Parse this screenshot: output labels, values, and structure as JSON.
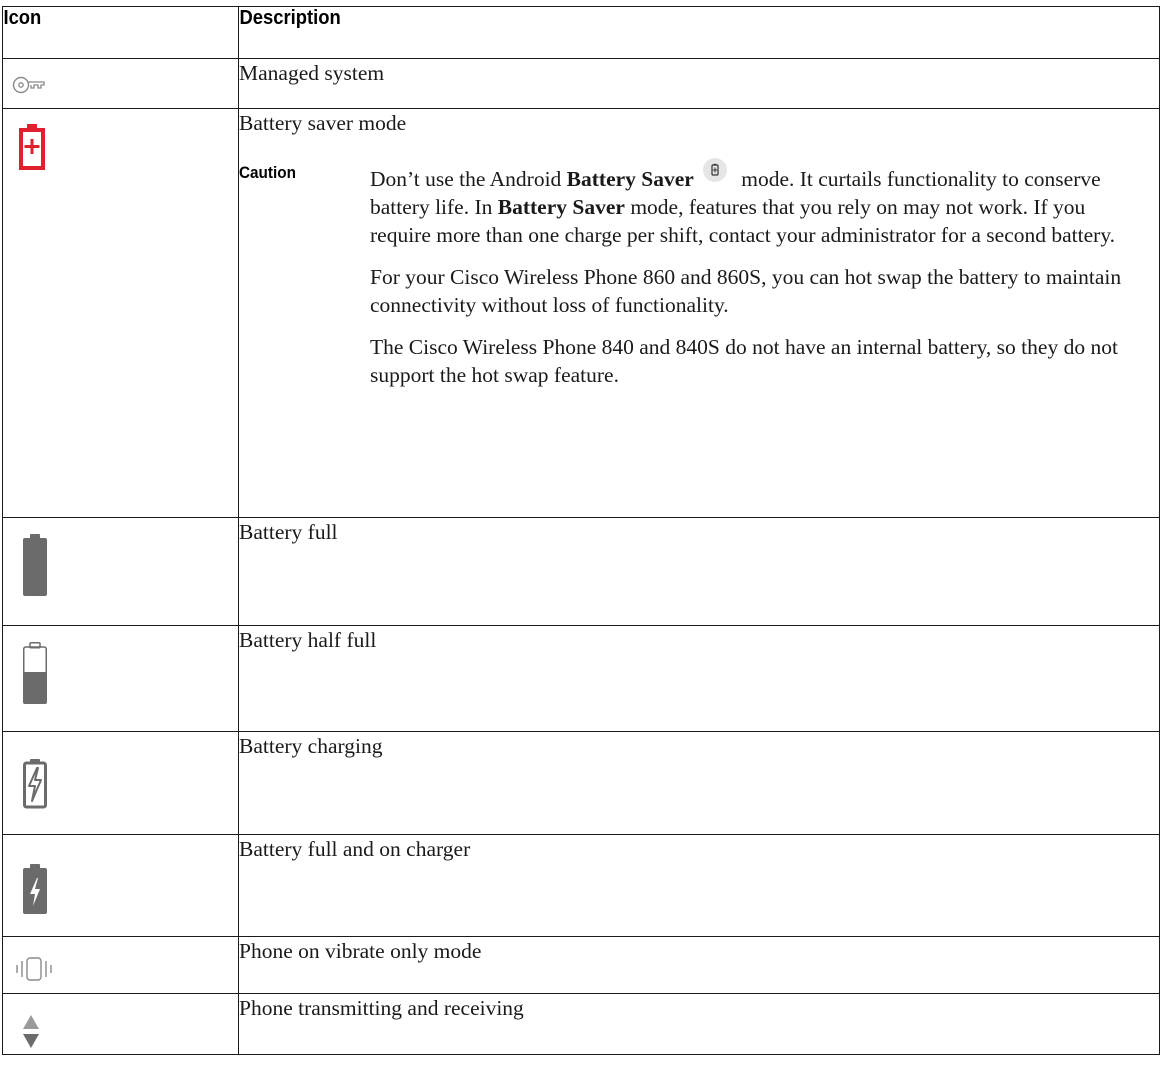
{
  "table": {
    "headers": {
      "icon": "Icon",
      "description": "Description"
    },
    "rows": [
      {
        "icon": "key-icon",
        "description": "Managed system"
      },
      {
        "icon": "battery-saver-icon",
        "description": "Battery saver mode"
      },
      {
        "icon": "battery-full-icon",
        "description": "Battery full"
      },
      {
        "icon": "battery-half-icon",
        "description": "Battery half full"
      },
      {
        "icon": "battery-charging-icon",
        "description": "Battery charging"
      },
      {
        "icon": "battery-full-charger-icon",
        "description": "Battery full and on charger"
      },
      {
        "icon": "vibrate-icon",
        "description": "Phone on vibrate only mode"
      },
      {
        "icon": "transmit-receive-icon",
        "description": "Phone transmitting and receiving"
      }
    ]
  },
  "caution": {
    "label": "Caution",
    "p1": {
      "t1": "Don’t use the Android ",
      "b1": "Battery Saver",
      "t2": " mode. It curtails functionality to conserve battery life. In ",
      "b2": "Battery Saver",
      "t3": " mode, features that you rely on may not work. If you require more than one charge per shift, contact your administrator for a second battery."
    },
    "p2": "For your Cisco Wireless Phone 860 and 860S, you can hot swap the battery to maintain connectivity without loss of functionality.",
    "p3": "The Cisco Wireless Phone 840 and 840S do not have an internal battery, so they do not support the hot swap feature."
  },
  "colors": {
    "border": "#1a1a1a",
    "icon_gray": "#6b6b6b",
    "battery_saver_red": "#e0202e"
  }
}
